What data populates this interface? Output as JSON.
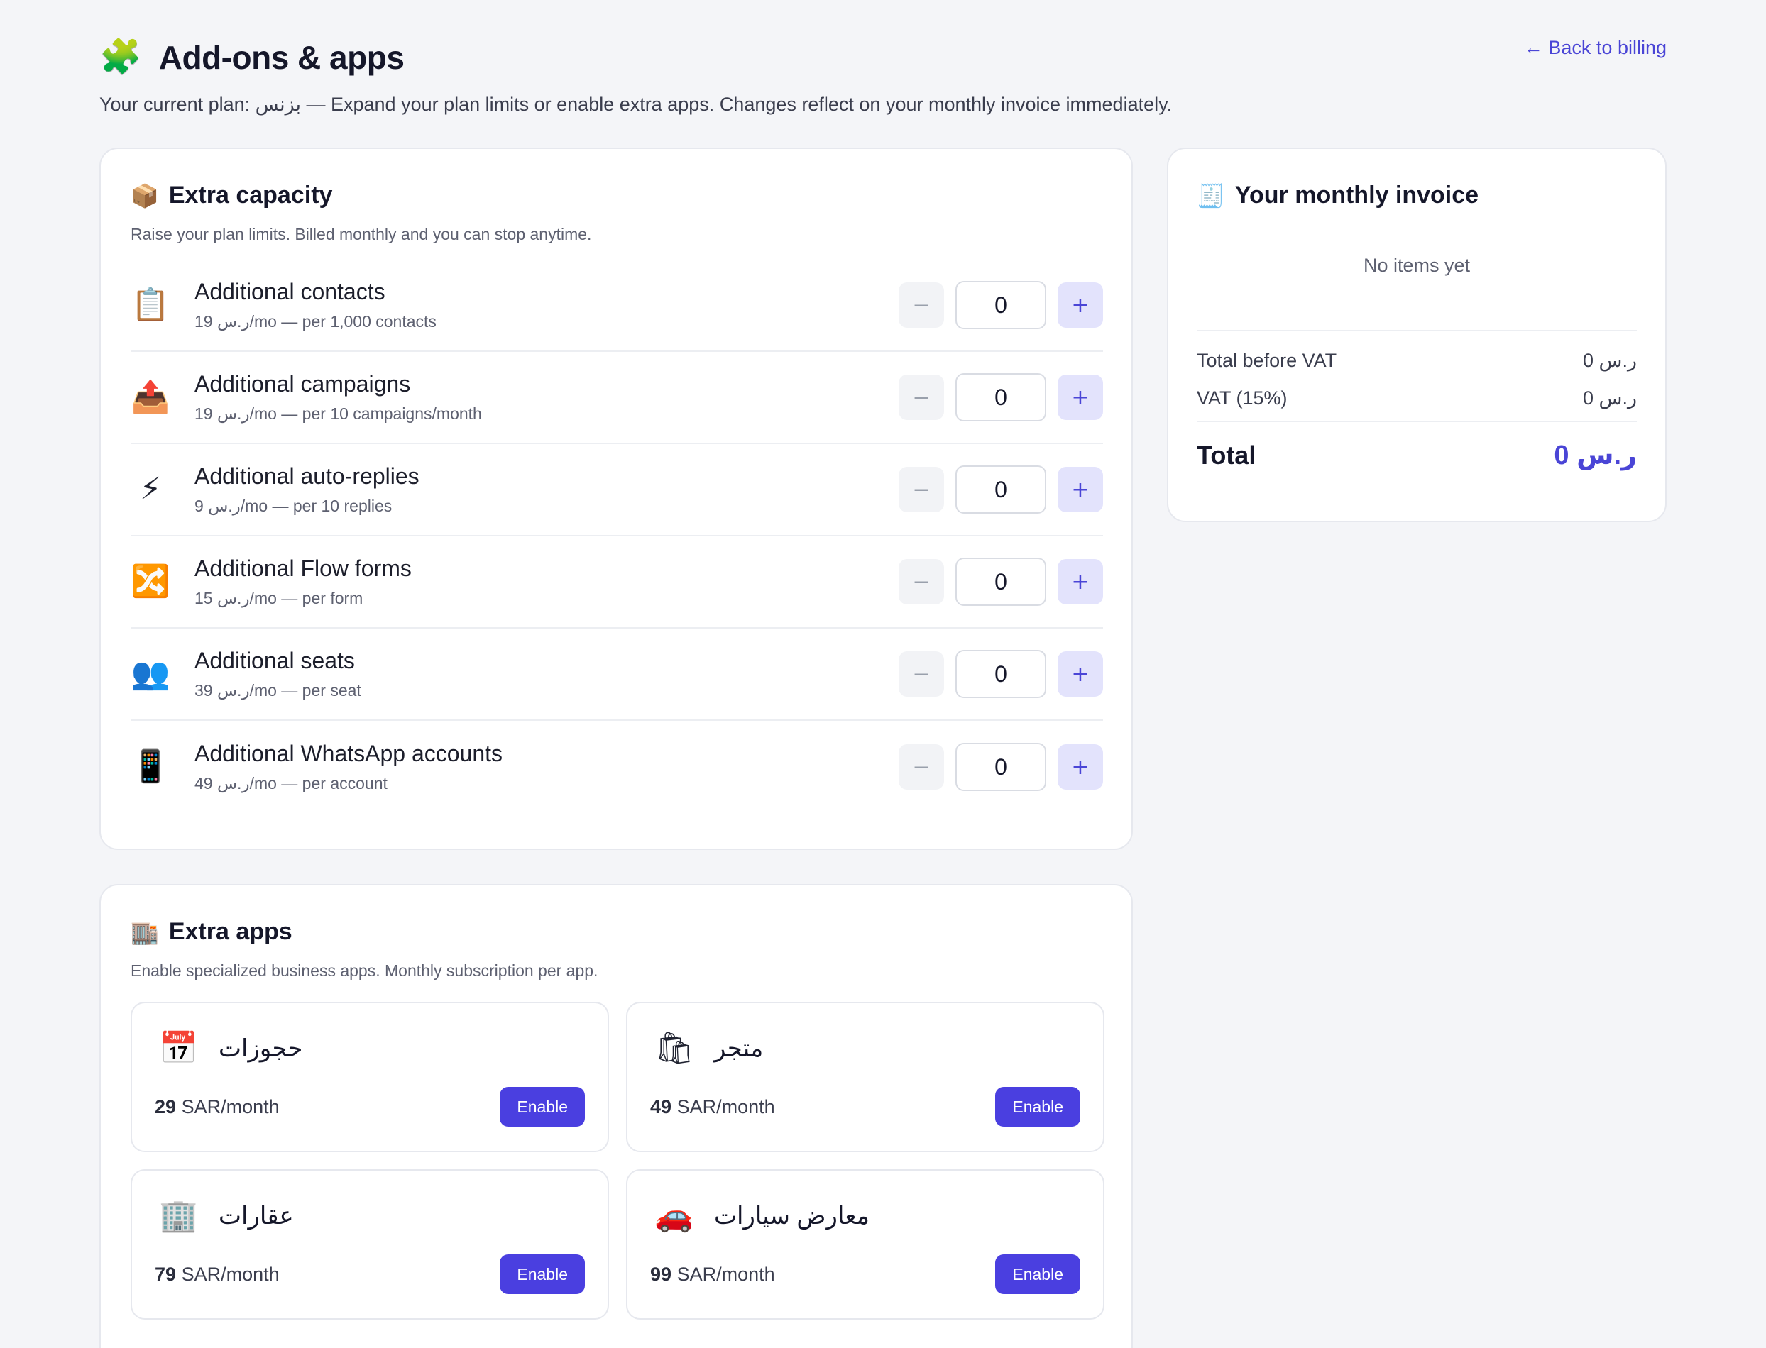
{
  "header": {
    "title_icon": "🧩",
    "title": "Add-ons & apps",
    "subtitle": "Your current plan: بزنس — Expand your plan limits or enable extra apps. Changes reflect on your monthly invoice immediately.",
    "back_link": "← Back to billing"
  },
  "capacity": {
    "icon": "📦",
    "title": "Extra capacity",
    "description": "Raise your plan limits. Billed monthly and you can stop anytime.",
    "items": [
      {
        "icon": "📋",
        "name": "Additional contacts",
        "price": "19 ر.س/mo — per 1,000 contacts",
        "value": "0"
      },
      {
        "icon": "📤",
        "name": "Additional campaigns",
        "price": "19 ر.س/mo — per 10 campaigns/month",
        "value": "0"
      },
      {
        "icon": "⚡",
        "name": "Additional auto-replies",
        "price": "9 ر.س/mo — per 10 replies",
        "value": "0"
      },
      {
        "icon": "🔀",
        "name": "Additional Flow forms",
        "price": "15 ر.س/mo — per form",
        "value": "0"
      },
      {
        "icon": "👥",
        "name": "Additional seats",
        "price": "39 ر.س/mo — per seat",
        "value": "0"
      },
      {
        "icon": "📱",
        "name": "Additional WhatsApp accounts",
        "price": "49 ر.س/mo — per account",
        "value": "0"
      }
    ],
    "minus": "−",
    "plus": "+"
  },
  "invoice": {
    "icon": "🧾",
    "title": "Your monthly invoice",
    "empty": "No items yet",
    "subtotal_label": "Total before VAT",
    "subtotal_value": "0 ر.س",
    "vat_label": "VAT (15%)",
    "vat_value": "0 ر.س",
    "total_label": "Total",
    "total_value": "0 ر.س"
  },
  "apps": {
    "icon": "🏬",
    "title": "Extra apps",
    "description": "Enable specialized business apps. Monthly subscription per app.",
    "items": [
      {
        "icon": "📅",
        "name": "حجوزات",
        "price_amount": "29",
        "price_unit": "SAR/month",
        "button": "Enable"
      },
      {
        "icon": "🛍",
        "name": "متجر",
        "price_amount": "49",
        "price_unit": "SAR/month",
        "button": "Enable"
      },
      {
        "icon": "🏢",
        "name": "عقارات",
        "price_amount": "79",
        "price_unit": "SAR/month",
        "button": "Enable"
      },
      {
        "icon": "🚗",
        "name": "معارض سيارات",
        "price_amount": "99",
        "price_unit": "SAR/month",
        "button": "Enable"
      }
    ]
  },
  "colors": {
    "accent": "#4a45d6",
    "button": "#4a3fe0",
    "background": "#f4f5f8"
  }
}
